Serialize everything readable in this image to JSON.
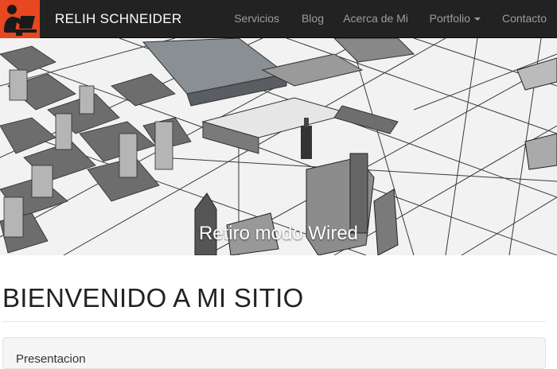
{
  "navbar": {
    "logo_icon": "person-at-laptop-icon",
    "brand": "RELIH SCHNEIDER",
    "items": [
      {
        "label": "Servicios"
      },
      {
        "label": "Blog"
      },
      {
        "label": "Acerca de Mi"
      },
      {
        "label": "Portfolio",
        "dropdown": true
      },
      {
        "label": "Contacto"
      }
    ]
  },
  "hero": {
    "caption": "Retiro modo Wired"
  },
  "main": {
    "heading": "BIENVENIDO A MI SITIO",
    "panel_title": "Presentacion"
  },
  "colors": {
    "navbar_bg": "#222222",
    "logo_bg": "#e8471f",
    "nav_text": "#9d9d9d"
  }
}
